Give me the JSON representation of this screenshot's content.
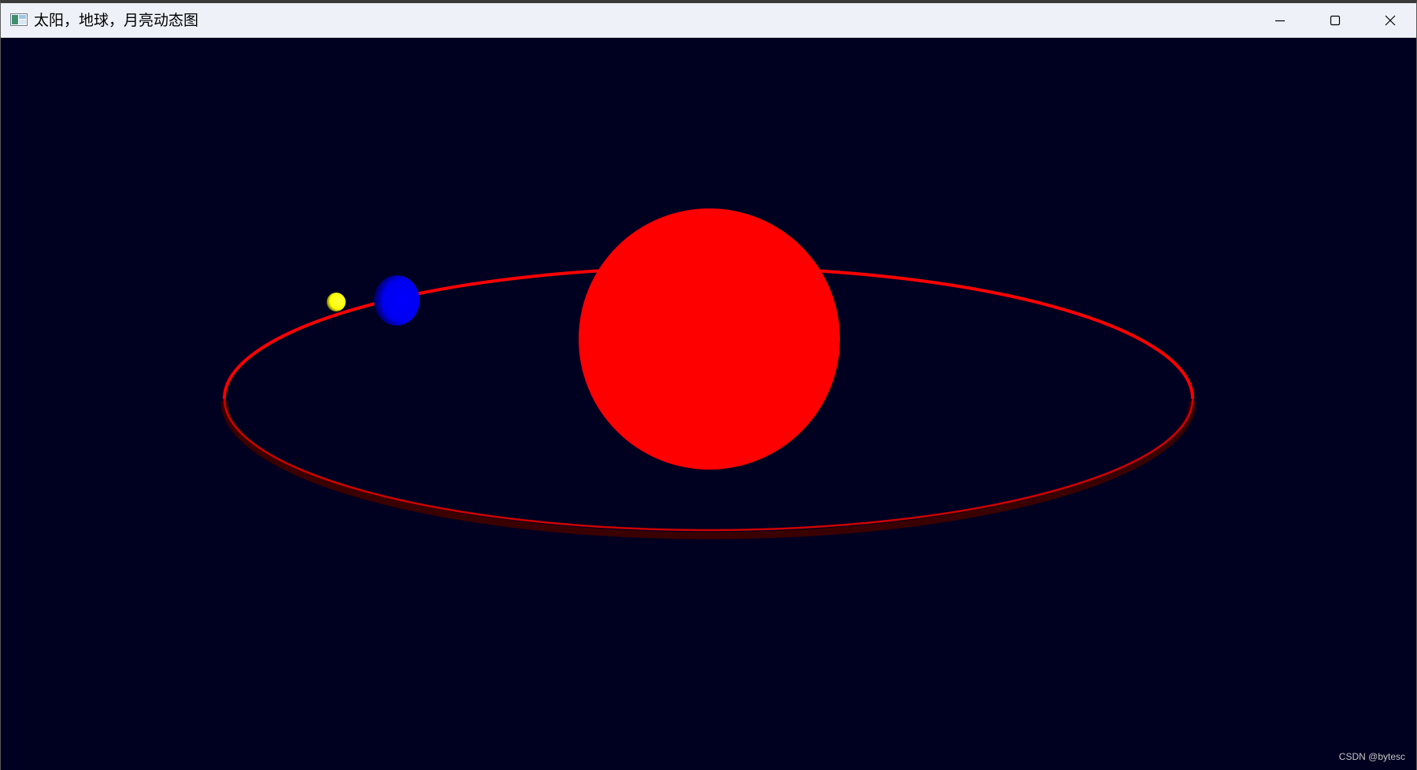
{
  "window": {
    "title": "太阳，地球，月亮动态图",
    "app_icon": "window-app-icon",
    "controls": {
      "minimize_icon": "minimize-icon",
      "maximize_icon": "maximize-icon",
      "close_icon": "close-icon"
    }
  },
  "scene": {
    "background_color": "#000020",
    "sun": {
      "color": "#ff0000"
    },
    "orbit": {
      "color": "#ff0000",
      "shadow_color": "#3a0000"
    },
    "earth": {
      "color": "#0000ff"
    },
    "moon": {
      "color": "#ffff00"
    }
  },
  "watermark": "CSDN @bytesc"
}
